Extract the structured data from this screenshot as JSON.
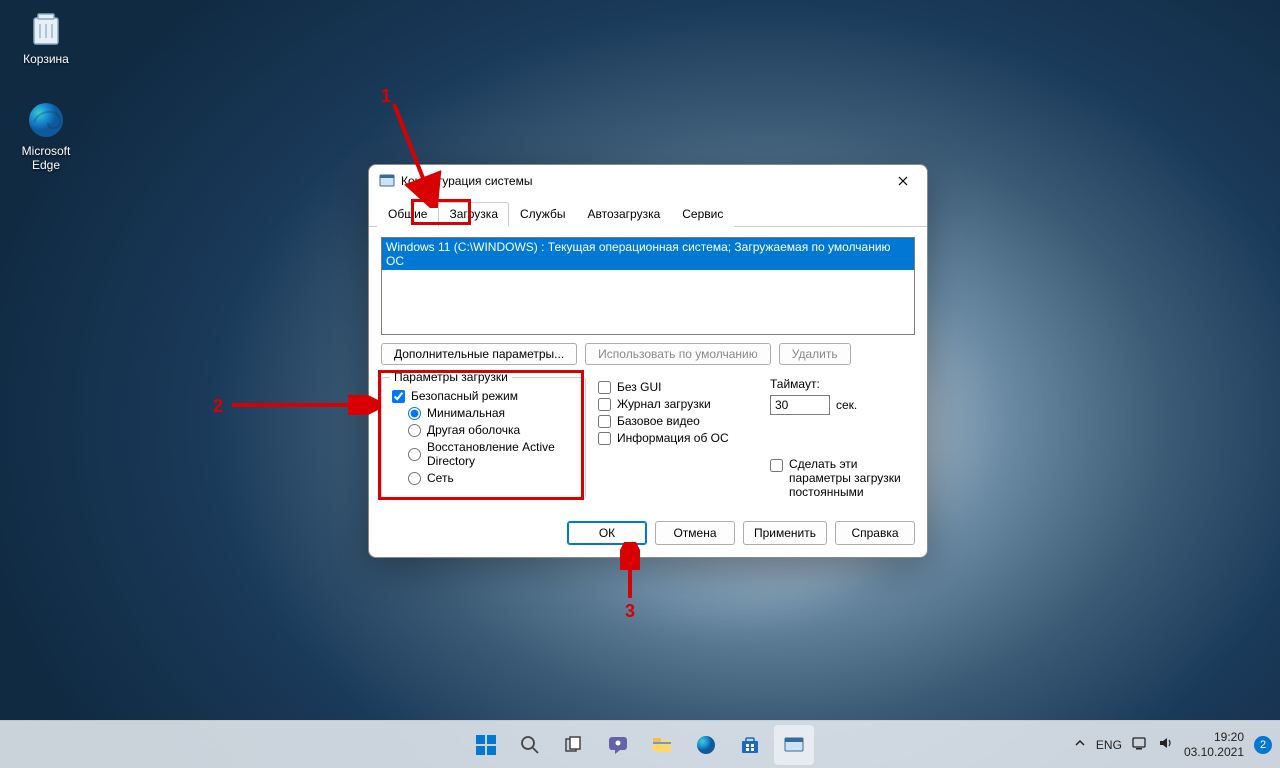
{
  "desktop": {
    "recycle_label": "Корзина",
    "edge_label": "Microsoft Edge"
  },
  "dialog": {
    "title": "Конфигурация системы",
    "tabs": {
      "general": "Общие",
      "boot": "Загрузка",
      "services": "Службы",
      "startup": "Автозагрузка",
      "tools": "Сервис"
    },
    "boot_entry": "Windows 11 (C:\\WINDOWS) : Текущая операционная система; Загружаемая по умолчанию ОС",
    "advanced_btn": "Дополнительные параметры...",
    "default_btn": "Использовать по умолчанию",
    "delete_btn": "Удалить",
    "boot_group_title": "Параметры загрузки",
    "safe_mode": "Безопасный режим",
    "minimal": "Минимальная",
    "altshell": "Другая оболочка",
    "ad_repair": "Восстановление Active Directory",
    "network": "Сеть",
    "no_gui": "Без GUI",
    "boot_log": "Журнал загрузки",
    "base_video": "Базовое видео",
    "os_info": "Информация  об ОС",
    "timeout_label": "Таймаут:",
    "timeout_value": "30",
    "timeout_unit": "сек.",
    "make_permanent": "Сделать эти параметры загрузки постоянными",
    "ok": "ОК",
    "cancel": "Отмена",
    "apply": "Применить",
    "help": "Справка"
  },
  "annotations": {
    "n1": "1",
    "n2": "2",
    "n3": "3"
  },
  "taskbar": {
    "lang": "ENG",
    "time": "19:20",
    "date": "03.10.2021",
    "badge": "2"
  }
}
